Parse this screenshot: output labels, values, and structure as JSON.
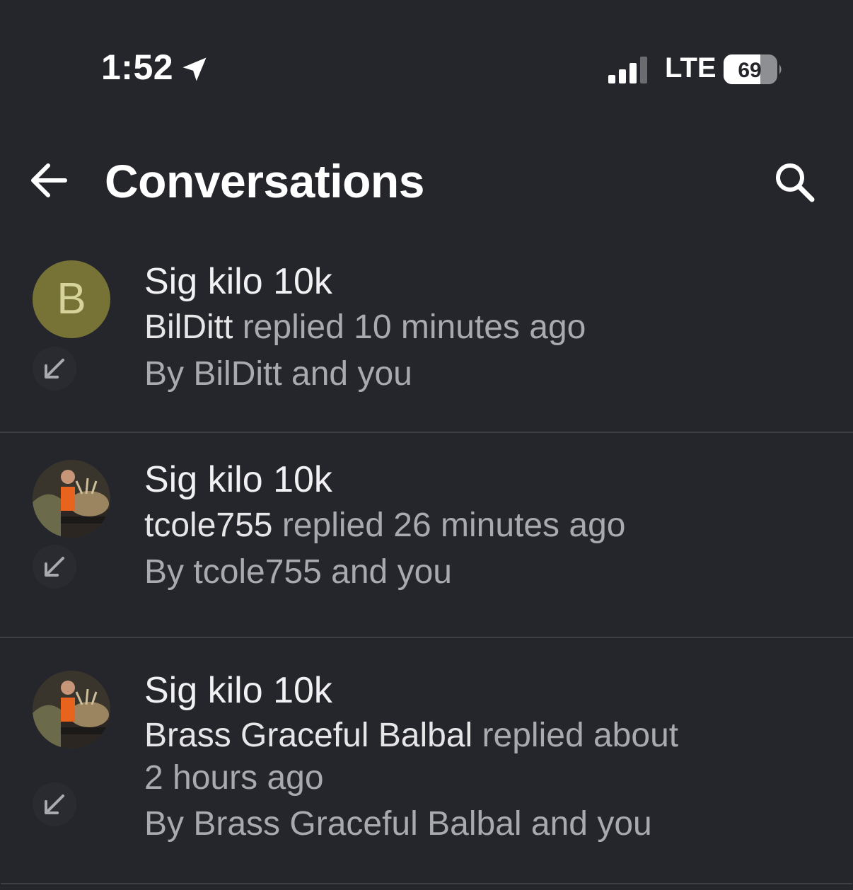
{
  "status_bar": {
    "time": "1:52",
    "network": "LTE",
    "battery": "69"
  },
  "header": {
    "title": "Conversations"
  },
  "conversations": [
    {
      "title": "Sig kilo 10k",
      "replier": "BilDitt",
      "reply_text": "replied 10 minutes ago",
      "by": "By BilDitt and you",
      "avatar_letter": "B"
    },
    {
      "title": "Sig kilo 10k",
      "replier": "tcole755",
      "reply_text": "replied 26 minutes ago",
      "by": "By tcole755 and you",
      "avatar_letter": ""
    },
    {
      "title": "Sig kilo 10k",
      "replier": "Brass Graceful Balbal",
      "reply_text": "replied about 2 hours ago",
      "by": "By Brass Graceful Balbal and you",
      "avatar_letter": ""
    }
  ]
}
